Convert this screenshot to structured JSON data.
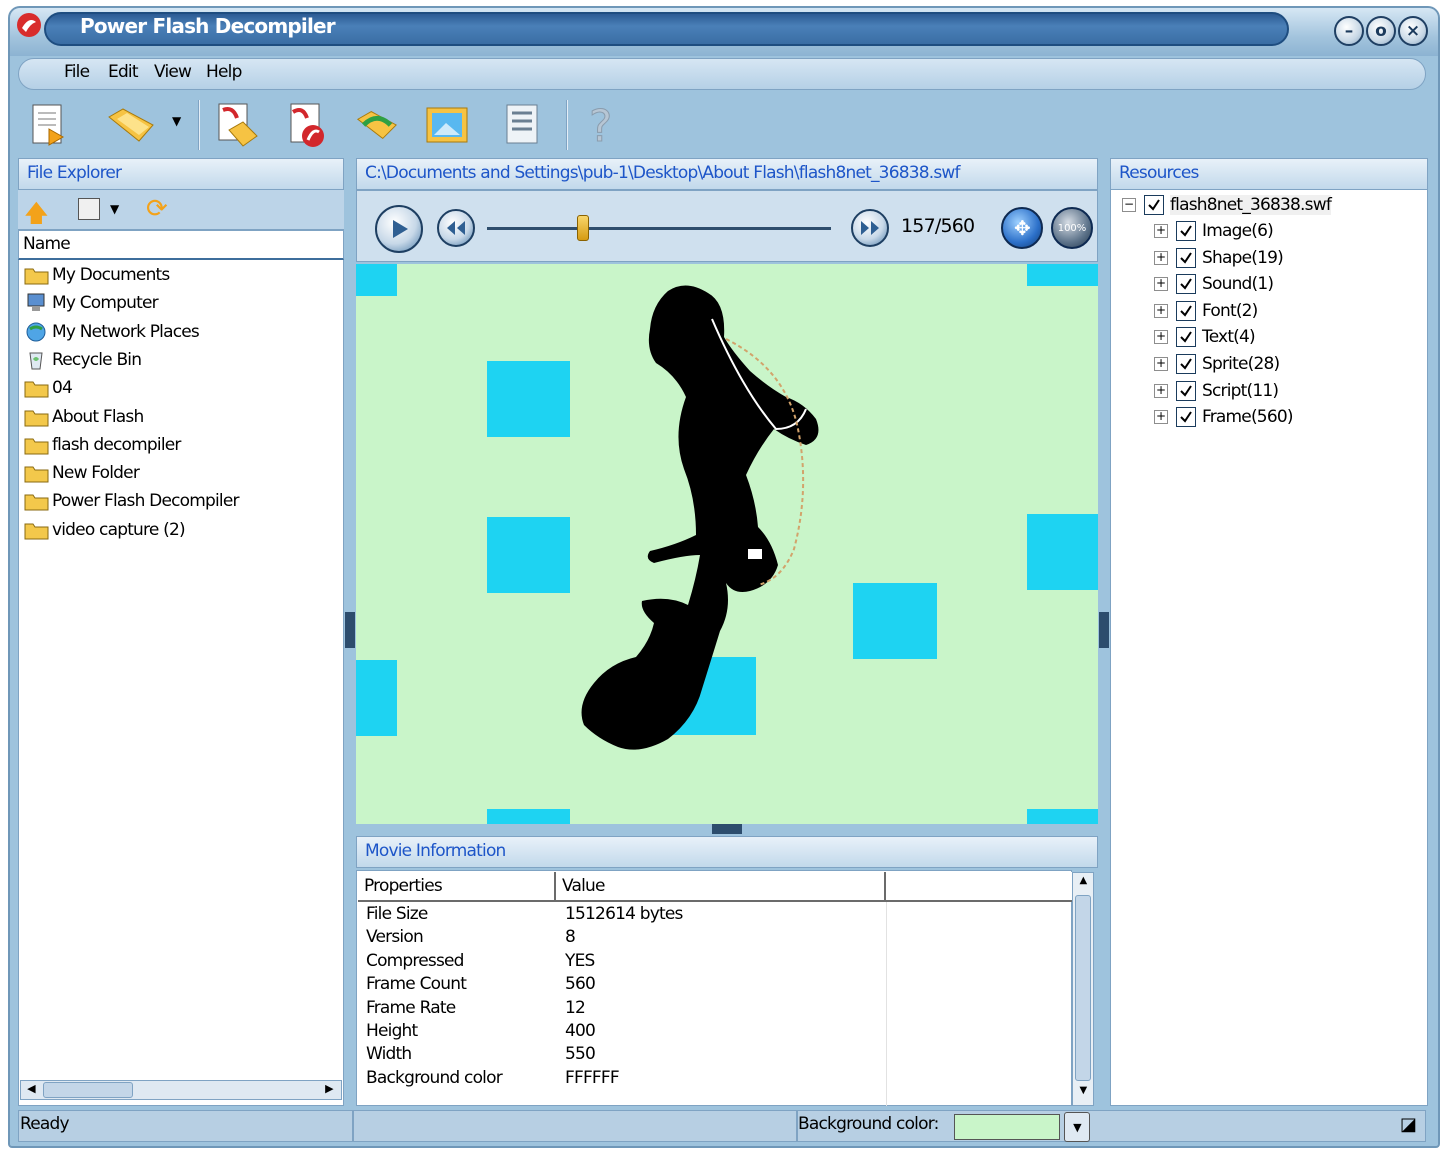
{
  "window": {
    "title": "Power Flash Decompiler",
    "controls": [
      "minimize",
      "restore",
      "close"
    ]
  },
  "menu": [
    "File",
    "Edit",
    "View",
    "Help"
  ],
  "toolbar": {
    "buttons": [
      "new-document-icon",
      "open-folder-icon",
      "export-icon",
      "export-flash-icon",
      "convert-icon",
      "image-icon",
      "properties-icon",
      "help-icon"
    ]
  },
  "file_explorer": {
    "title": "File Explorer",
    "column_header": "Name",
    "items": [
      {
        "label": "My Documents",
        "icon": "documents-folder-icon"
      },
      {
        "label": "My Computer",
        "icon": "computer-icon"
      },
      {
        "label": "My Network Places",
        "icon": "network-icon"
      },
      {
        "label": "Recycle Bin",
        "icon": "recycle-bin-icon"
      },
      {
        "label": "04",
        "icon": "folder-icon"
      },
      {
        "label": "About Flash",
        "icon": "folder-icon"
      },
      {
        "label": "flash decompiler",
        "icon": "folder-icon"
      },
      {
        "label": "New Folder",
        "icon": "folder-icon"
      },
      {
        "label": "Power Flash Decompiler",
        "icon": "folder-icon"
      },
      {
        "label": "video capture (2)",
        "icon": "folder-icon"
      }
    ]
  },
  "player": {
    "path": "C:\\Documents and Settings\\pub-1\\Desktop\\About Flash\\flash8net_36838.swf",
    "frame_counter": "157/560",
    "progress": 0.28,
    "zoom_label": "100%"
  },
  "movie_info": {
    "title": "Movie Information",
    "headers": [
      "Properties",
      "Value",
      ""
    ],
    "rows": [
      {
        "property": "File Size",
        "value": "1512614 bytes"
      },
      {
        "property": "Version",
        "value": "8"
      },
      {
        "property": "Compressed",
        "value": "YES"
      },
      {
        "property": "Frame Count",
        "value": "560"
      },
      {
        "property": "Frame Rate",
        "value": "12"
      },
      {
        "property": "Height",
        "value": "400"
      },
      {
        "property": "Width",
        "value": "550"
      },
      {
        "property": "Background color",
        "value": "FFFFFF"
      }
    ]
  },
  "resources": {
    "title": "Resources",
    "root": "flash8net_36838.swf",
    "items": [
      "Image(6)",
      "Shape(19)",
      "Sound(1)",
      "Font(2)",
      "Text(4)",
      "Sprite(28)",
      "Script(11)",
      "Frame(560)"
    ]
  },
  "status": {
    "text": "Ready",
    "background_color_label": "Background color:",
    "background_color_swatch": "#c9f5c9"
  },
  "colors": {
    "stage_background": "#c9f5c9",
    "stage_squares": "#1ed3f2",
    "panel_title": "#1d55c8",
    "title_bar": "#3a6da4"
  }
}
